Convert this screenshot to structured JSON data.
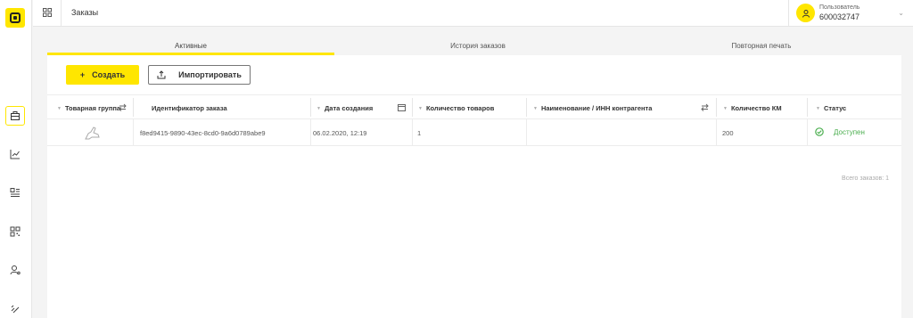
{
  "header": {
    "title": "Заказы",
    "user_role": "Пользователь",
    "user_id": "600032747"
  },
  "sidebar": {
    "items": [
      {
        "icon": "briefcase-icon",
        "active": true
      },
      {
        "icon": "chart-icon",
        "active": false
      },
      {
        "icon": "list-icon",
        "active": false
      },
      {
        "icon": "qr-code-icon",
        "active": false
      },
      {
        "icon": "user-settings-icon",
        "active": false
      },
      {
        "icon": "link-icon",
        "active": false
      }
    ]
  },
  "tabs": [
    {
      "label": "Активные",
      "active": true
    },
    {
      "label": "История заказов",
      "active": false
    },
    {
      "label": "Повторная печать",
      "active": false
    }
  ],
  "toolbar": {
    "create_label": "Создать",
    "import_label": "Импортировать"
  },
  "table": {
    "columns": [
      "Товарная группа",
      "Идентификатор заказа",
      "Дата создания",
      "Количество товаров",
      "Наименование / ИНН контрагента",
      "Количество КМ",
      "Статус"
    ],
    "rows": [
      {
        "product_group_icon": "shoe-icon",
        "order_id": "f8ed9415-9890-43ec-8cd0-9a6d0789abe9",
        "created": "06.02.2020, 12:19",
        "items_count": "1",
        "counterparty": "",
        "km_count": "200",
        "status": "Доступен"
      }
    ],
    "total": "Всего заказов: 1"
  },
  "colors": {
    "accent": "#ffe600",
    "status_ok": "#4caf50"
  }
}
